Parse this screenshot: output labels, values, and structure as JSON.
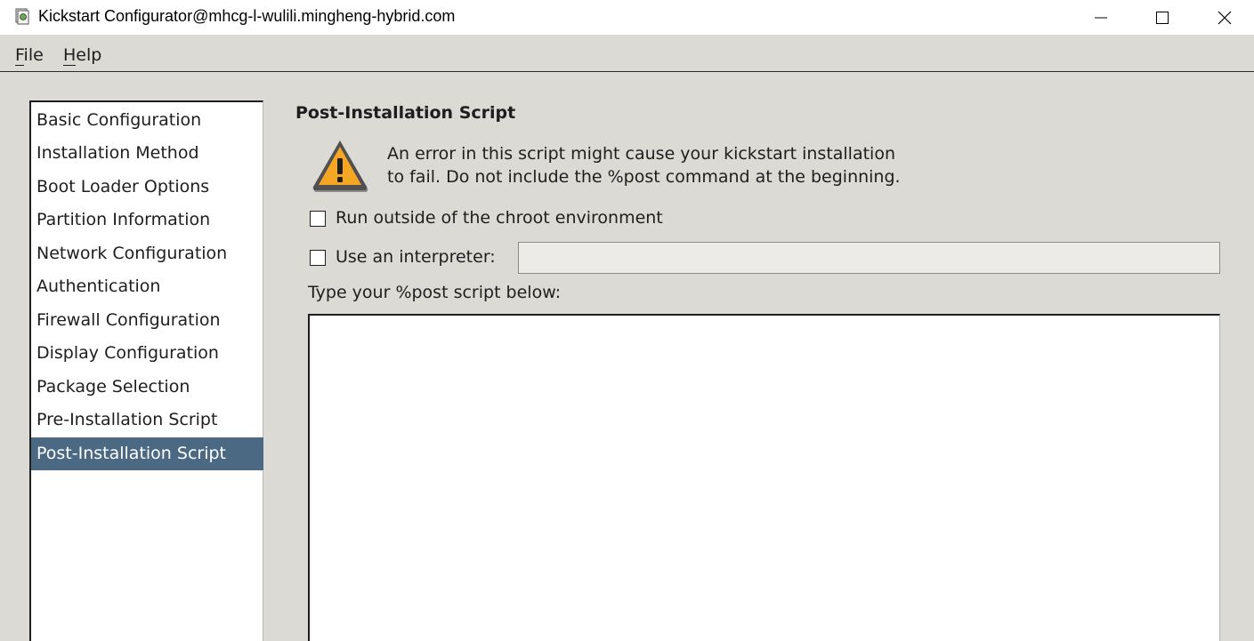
{
  "window": {
    "title": "Kickstart Configurator@mhcg-l-wulili.mingheng-hybrid.com"
  },
  "menu": {
    "file": {
      "label": "File",
      "mnemonic": "F"
    },
    "help": {
      "label": "Help",
      "mnemonic": "H"
    }
  },
  "sidebar": {
    "items": [
      {
        "label": "Basic Configuration",
        "selected": false
      },
      {
        "label": "Installation Method",
        "selected": false
      },
      {
        "label": "Boot Loader Options",
        "selected": false
      },
      {
        "label": "Partition Information",
        "selected": false
      },
      {
        "label": "Network Configuration",
        "selected": false
      },
      {
        "label": "Authentication",
        "selected": false
      },
      {
        "label": "Firewall Configuration",
        "selected": false
      },
      {
        "label": "Display Configuration",
        "selected": false
      },
      {
        "label": "Package Selection",
        "selected": false
      },
      {
        "label": "Pre-Installation Script",
        "selected": false
      },
      {
        "label": "Post-Installation Script",
        "selected": true
      }
    ]
  },
  "main": {
    "title": "Post-Installation Script",
    "warning": {
      "icon": "warning-triangle-icon",
      "line1": "An error in this script might cause your kickstart installation",
      "line2": "to fail. Do not include the %post command at the beginning."
    },
    "chroot_checkbox": {
      "label": "Run outside of the chroot environment",
      "checked": false
    },
    "interpreter_checkbox": {
      "label": "Use an interpreter:",
      "checked": false
    },
    "interpreter_value": "",
    "script_label": "Type your %post script below:",
    "script_value": ""
  },
  "colors": {
    "selection": "#4b6983",
    "window_bg": "#dcdad5",
    "warning_fill": "#f5a623"
  }
}
